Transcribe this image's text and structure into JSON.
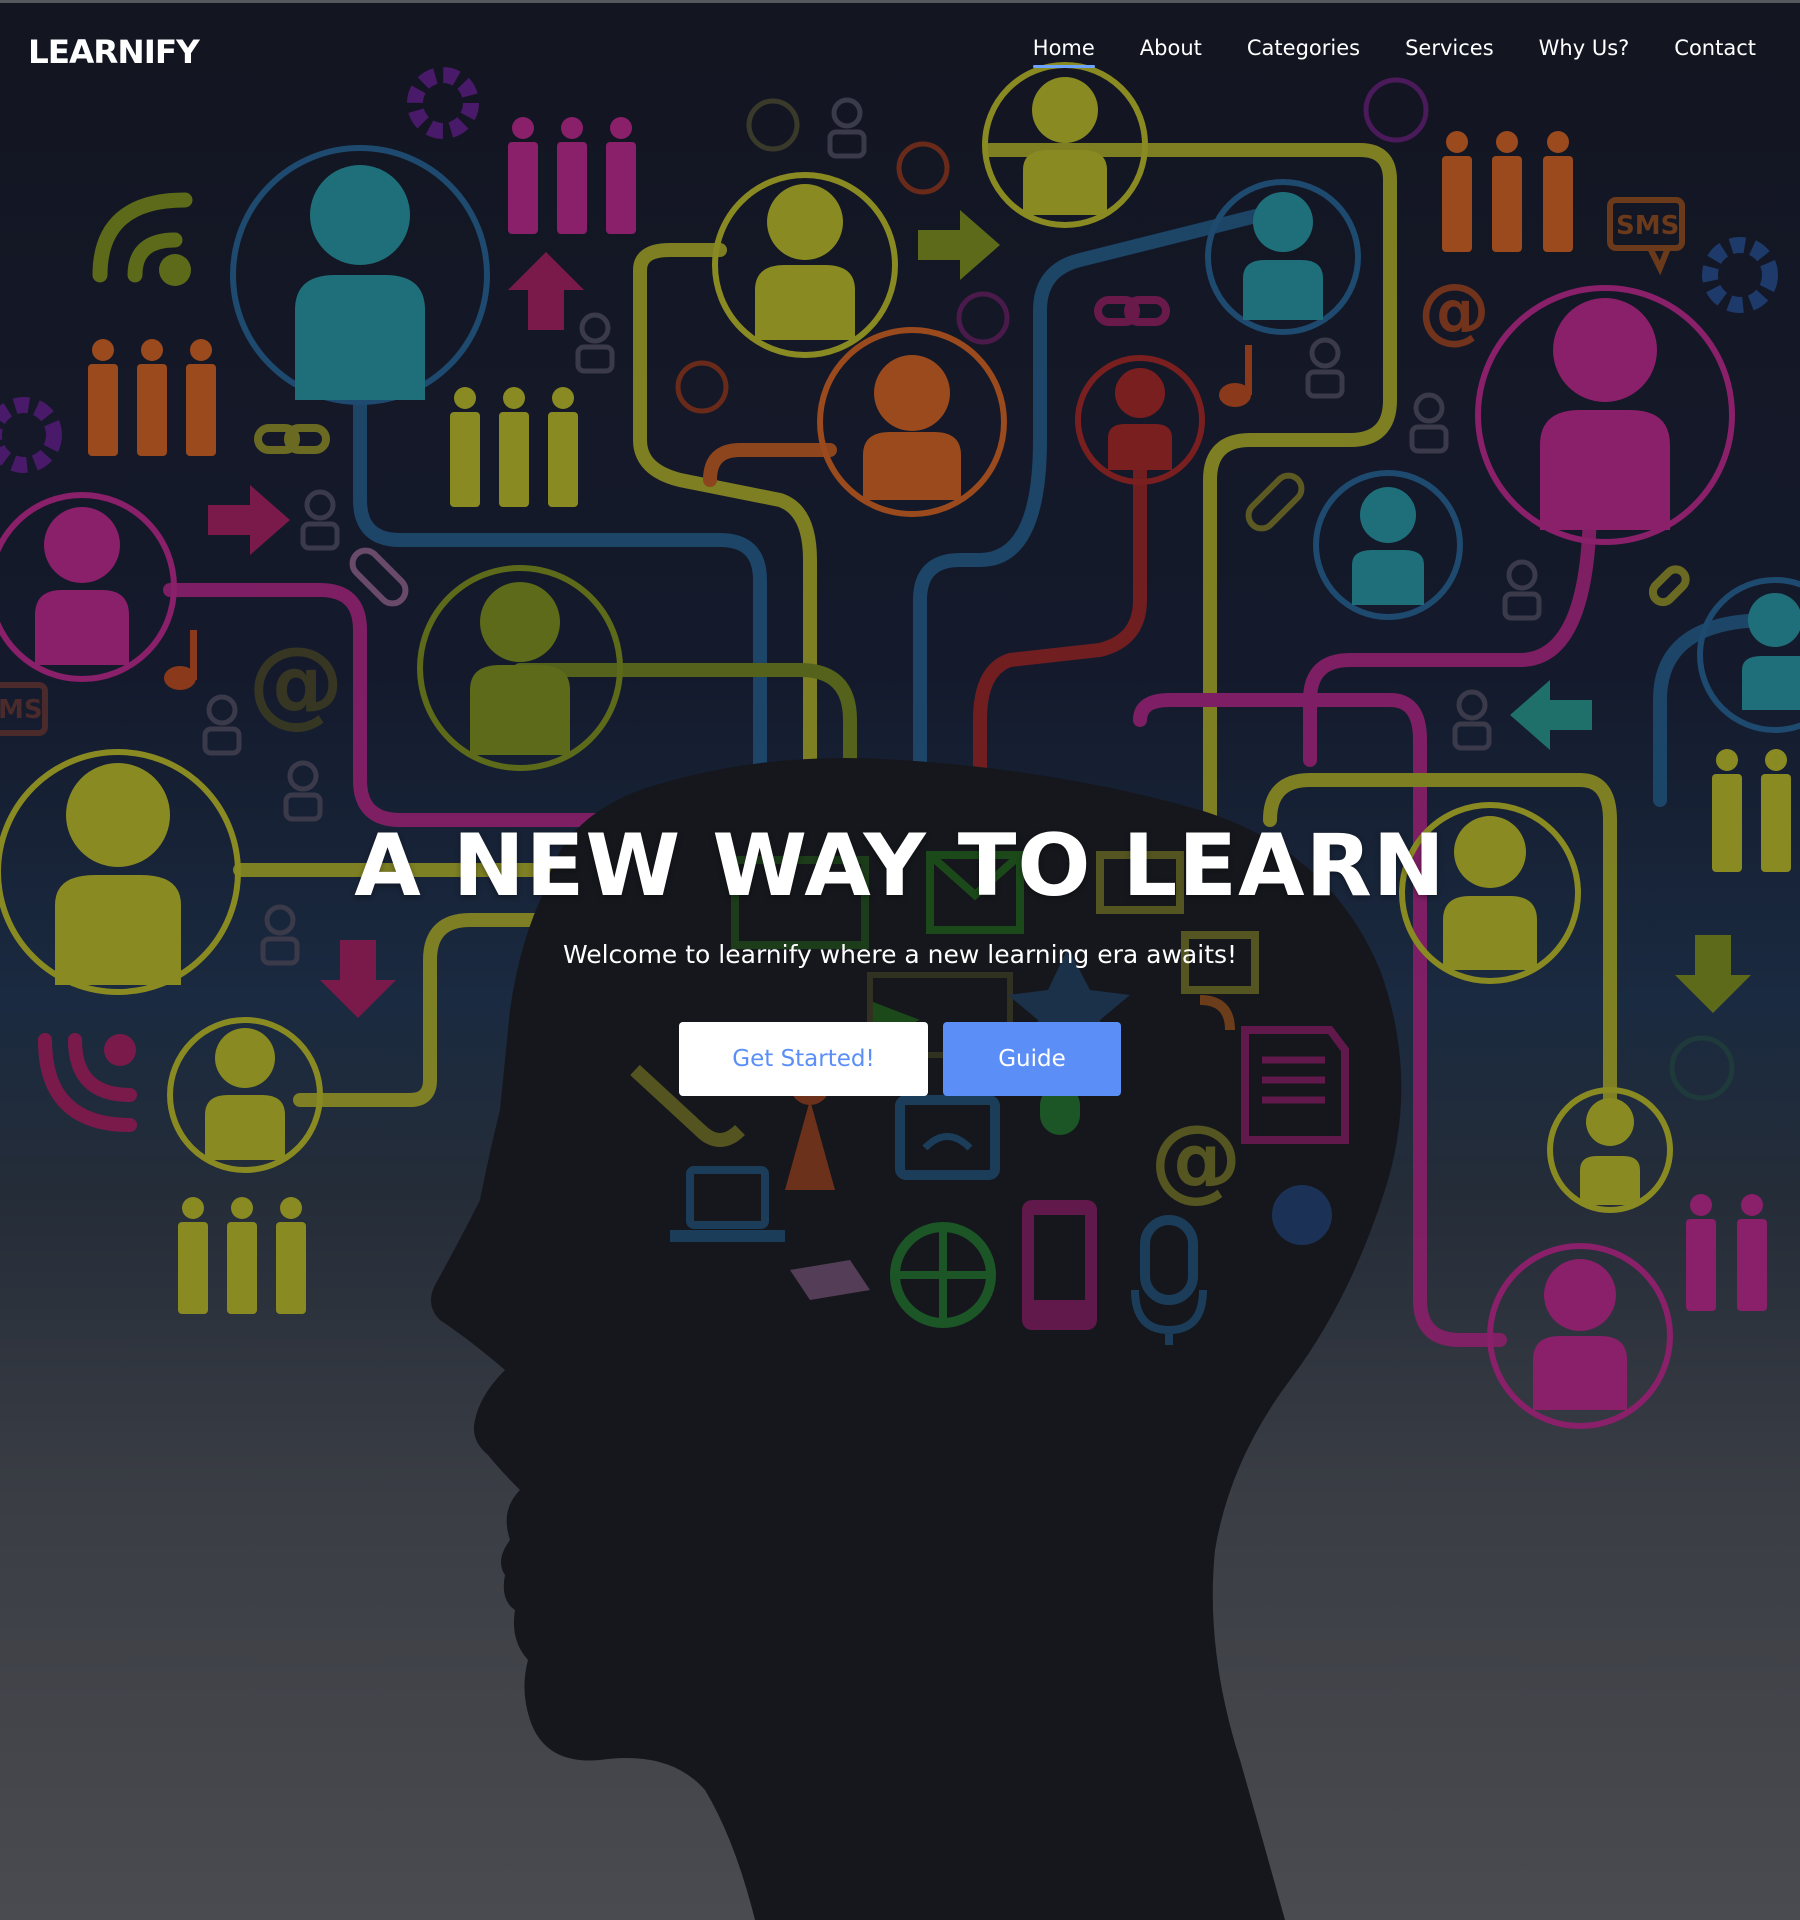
{
  "brand": {
    "logo": "LEARNIFY"
  },
  "nav": {
    "items": [
      {
        "label": "Home",
        "active": true
      },
      {
        "label": "About"
      },
      {
        "label": "Categories"
      },
      {
        "label": "Services"
      },
      {
        "label": "Why Us?"
      },
      {
        "label": "Contact"
      }
    ]
  },
  "hero": {
    "title": "A NEW WAY TO LEARN",
    "subtitle": "Welcome to learnify where a new learning era awaits!",
    "primary_button": "Get Started!",
    "secondary_button": "Guide",
    "background_icons": [
      "person-icon",
      "people-group-icon",
      "gear-icon",
      "wifi-icon",
      "arrow-icon",
      "chain-link-icon",
      "at-sign-icon",
      "paperclip-icon",
      "music-note-icon",
      "sms-bubble-icon",
      "globe-icon",
      "microphone-icon",
      "phone-icon",
      "laptop-icon",
      "monitor-icon",
      "document-icon"
    ],
    "background_labels": [
      "SMS",
      "MS",
      "@"
    ]
  },
  "colors": {
    "accent": "#5b8ff7",
    "nav_underline": "#6ea2ff",
    "yellow": "#8a8a22",
    "teal": "#1f6f7a",
    "magenta": "#8a1f6a",
    "orange": "#9a4a1c",
    "blue_line": "#1d4a6e",
    "head_silhouette": "#15171c"
  }
}
